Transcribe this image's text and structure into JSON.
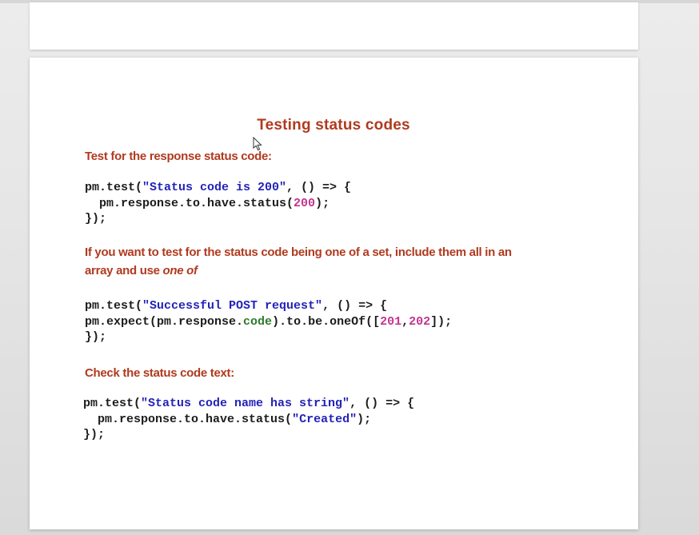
{
  "slide": {
    "title": "Testing status codes",
    "sections": [
      {
        "heading": "Test for the response status code:",
        "code": [
          [
            "pm.test(",
            "\"Status code is 200\"",
            ", () => {"
          ],
          [
            "  pm.response.to.have.status(",
            "200",
            ");"
          ],
          [
            "});"
          ]
        ]
      },
      {
        "heading_line1": "If you want to test for the status code being one of a set, include them all in an",
        "heading_line2": "array and use ",
        "heading_emphasis": "one of",
        "code": [
          [
            "pm.test(",
            "\"Successful POST request\"",
            ", () => {"
          ],
          [
            "pm.expect(pm.response.",
            "code",
            ").to.be.oneOf([",
            "201",
            ",",
            "202",
            "]);"
          ],
          [
            "});"
          ]
        ]
      },
      {
        "heading": "Check the status code text:",
        "code": [
          [
            "  pm.test(",
            "\"Status code name has string\"",
            ", () => {"
          ],
          [
            "  pm.response.to.have.status(",
            "\"Created\"",
            ");"
          ],
          [
            "});"
          ]
        ]
      }
    ]
  },
  "colors": {
    "heading": "#b03a1f",
    "code_text": "#1c1c1c",
    "code_string": "#2323b8",
    "code_number": "#c4348f",
    "code_property": "#2e7a2e",
    "slide_background": "#ffffff",
    "page_background": "#e6e6e6"
  },
  "icons": {
    "cursor": "mouse-pointer-icon"
  }
}
